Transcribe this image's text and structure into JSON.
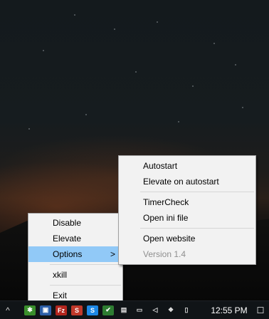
{
  "context_menu": {
    "items": [
      {
        "label": "Disable"
      },
      {
        "label": "Elevate"
      },
      {
        "label": "Options",
        "has_submenu": true,
        "highlighted": true
      },
      {
        "label": "xkill"
      },
      {
        "label": "Exit"
      }
    ]
  },
  "submenu": {
    "items": [
      {
        "label": "Autostart"
      },
      {
        "label": "Elevate on autostart"
      },
      {
        "label": "TimerCheck"
      },
      {
        "label": "Open ini file"
      },
      {
        "label": "Open website"
      },
      {
        "label": "Version 1.4",
        "disabled": true
      }
    ]
  },
  "taskbar": {
    "expand_glyph": "^",
    "submenu_arrow_glyph": ">",
    "clock": "12:55 PM",
    "tray_icons": [
      {
        "name": "app-green-icon",
        "color": "#3a8f2c",
        "glyph": "✱"
      },
      {
        "name": "network-app-icon",
        "color": "#2d5fa8",
        "glyph": "▣"
      },
      {
        "name": "filezilla-icon",
        "color": "#b3261e",
        "glyph": "Fz"
      },
      {
        "name": "red-s-app-icon",
        "color": "#c0392b",
        "glyph": "S"
      },
      {
        "name": "skype-icon",
        "color": "#1e88e5",
        "glyph": "S"
      },
      {
        "name": "green-check-icon",
        "color": "#2e7d32",
        "glyph": "✔"
      },
      {
        "name": "gpu-icon",
        "color": "#dddddd",
        "glyph": "▤"
      },
      {
        "name": "monitor-icon",
        "color": "#dddddd",
        "glyph": "▭"
      },
      {
        "name": "volume-icon",
        "color": "#dddddd",
        "glyph": "◁"
      },
      {
        "name": "dropbox-icon",
        "color": "#dddddd",
        "glyph": "❖"
      },
      {
        "name": "battery-icon",
        "color": "#dddddd",
        "glyph": "▯"
      }
    ]
  }
}
